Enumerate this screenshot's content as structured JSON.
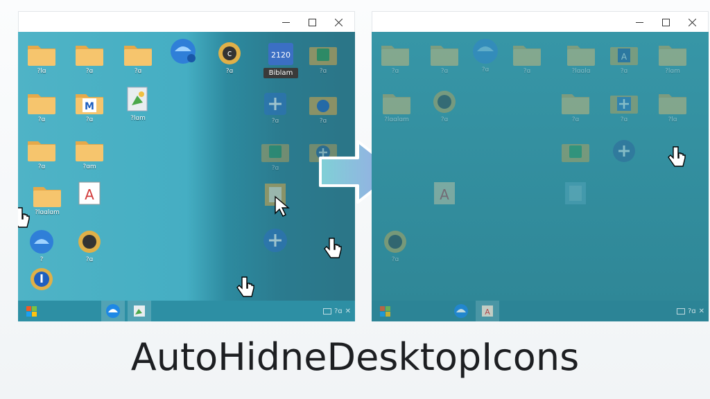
{
  "app_title": "AutoHidneDesktopIcons",
  "left_window": {
    "controls": [
      "minimize-icon",
      "maximize-icon",
      "close-icon"
    ],
    "icons": [
      {
        "type": "folder",
        "label": "?lɑ"
      },
      {
        "type": "folder",
        "label": "?ɑ"
      },
      {
        "type": "folder",
        "label": "?ɑ"
      },
      {
        "type": "blue-app",
        "label": ""
      },
      {
        "type": "yellow-app",
        "label": "?ɑ"
      },
      {
        "type": "calendar-app",
        "label": "2120",
        "chip": "Biblam"
      },
      {
        "type": "green-folder",
        "label": "?ɑ"
      },
      {
        "type": "folder",
        "label": "?ɑ"
      },
      {
        "type": "m-folder",
        "label": "?ɑ"
      },
      {
        "type": "green-doc",
        "label": "?lɑm"
      },
      {
        "type": "plus-app",
        "label": "?ɑ"
      },
      {
        "type": "blue-folder",
        "label": "?ɑ"
      },
      {
        "type": "folder",
        "label": "?ɑ"
      },
      {
        "type": "folder",
        "label": "?ɑm"
      },
      {
        "type": "green-folder",
        "label": "?ɑ"
      },
      {
        "type": "plus-folder",
        "label": "?ɑ"
      },
      {
        "type": "folder",
        "label": "?lɑɑlɑm"
      },
      {
        "type": "a-doc",
        "label": ""
      },
      {
        "type": "doc",
        "label": ""
      },
      {
        "type": "blue-app",
        "label": "?"
      },
      {
        "type": "yellow-app",
        "label": "?ɑ"
      },
      {
        "type": "plus-app",
        "label": ""
      },
      {
        "type": "info-app",
        "label": ""
      }
    ],
    "taskbar": {
      "start": "windows-start-icon",
      "apps": [
        "edge-icon",
        "green-doc-icon"
      ],
      "tray_text": "?ɑ"
    }
  },
  "right_window": {
    "controls": [
      "minimize-icon",
      "maximize-icon",
      "close-icon"
    ],
    "icons": [
      {
        "type": "folder",
        "label": "?ɑ"
      },
      {
        "type": "folder",
        "label": "?ɑ"
      },
      {
        "type": "blue-app",
        "label": "?ɑ"
      },
      {
        "type": "folder",
        "label": "?ɑ"
      },
      {
        "type": "folder",
        "label": "?lɑɑlɑ"
      },
      {
        "type": "a-folder",
        "label": "?ɑ"
      },
      {
        "type": "folder",
        "label": "?lɑm"
      },
      {
        "type": "folder",
        "label": "?lɑɑlɑm"
      },
      {
        "type": "yellow-app",
        "label": "?ɑ"
      },
      {
        "type": "folder",
        "label": "?ɑ"
      },
      {
        "type": "plus-folder",
        "label": "?ɑ"
      },
      {
        "type": "folder",
        "label": "?lɑ"
      },
      {
        "type": "green-doc",
        "label": ""
      },
      {
        "type": "plus-app",
        "label": ""
      },
      {
        "type": "a-doc",
        "label": ""
      },
      {
        "type": "doc",
        "label": ""
      },
      {
        "type": "yellow-app",
        "label": "?ɑ"
      }
    ],
    "taskbar": {
      "start": "windows-start-icon",
      "apps": [
        "edge-icon",
        "a-doc-icon"
      ],
      "tray_text": "?ɑ"
    }
  },
  "colors": {
    "left_desktop": "#45aec3",
    "right_desktop": "#3796a7",
    "folder": "#f5c56b",
    "title_text": "#1d1f22"
  }
}
